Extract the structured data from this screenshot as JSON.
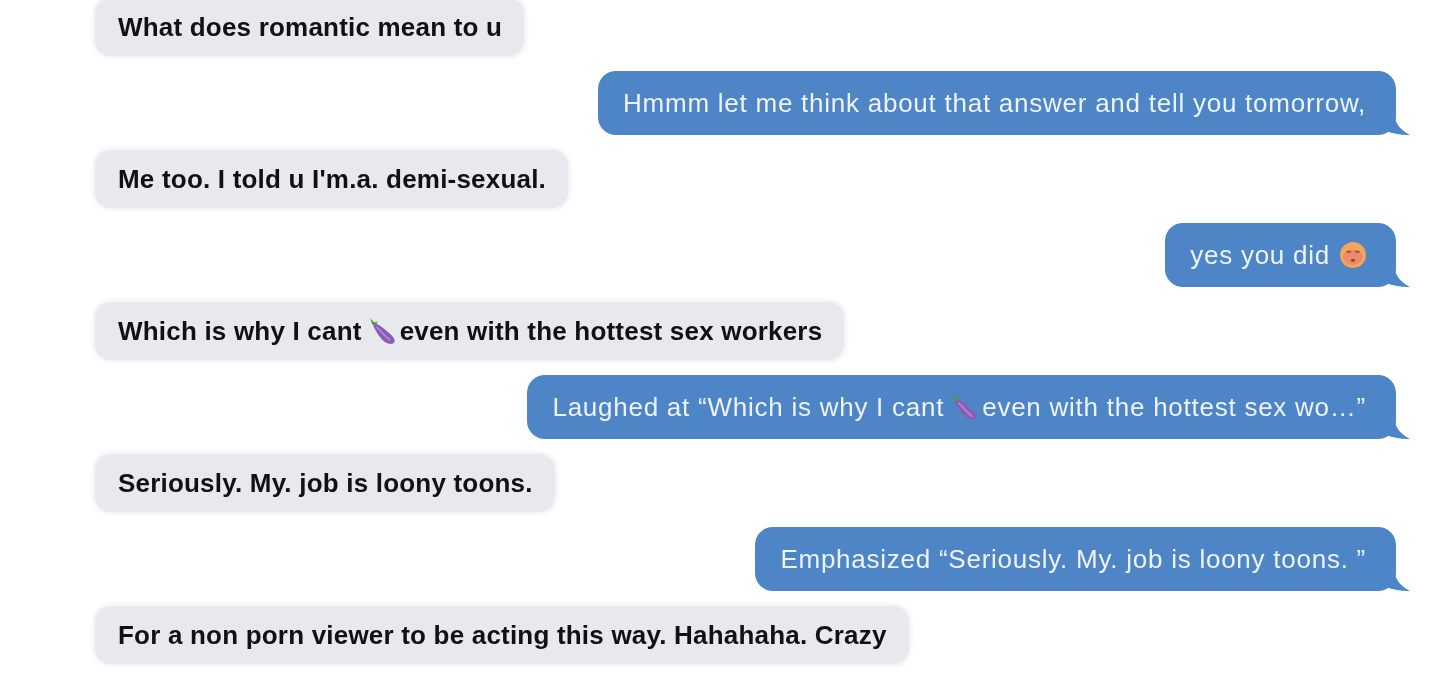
{
  "messages": [
    {
      "kind": "received",
      "parts": [
        {
          "kind": "text",
          "text": "What does romantic mean to u"
        }
      ]
    },
    {
      "kind": "sent",
      "parts": [
        {
          "kind": "text",
          "text": "Hmmm let me think about that answer and tell you tomorrow,"
        }
      ]
    },
    {
      "kind": "received",
      "parts": [
        {
          "kind": "text",
          "text": "Me too. I told u I'm.a. demi-sexual."
        }
      ]
    },
    {
      "kind": "sent",
      "parts": [
        {
          "kind": "text",
          "text": "yes you did"
        },
        {
          "kind": "face"
        }
      ]
    },
    {
      "kind": "received",
      "parts": [
        {
          "kind": "text",
          "text": "Which is why I cant"
        },
        {
          "kind": "eggplant"
        },
        {
          "kind": "text",
          "text": "even with the hottest sex workers"
        }
      ]
    },
    {
      "kind": "sent",
      "parts": [
        {
          "kind": "text",
          "text": "Laughed at “Which is why I cant"
        },
        {
          "kind": "eggplant"
        },
        {
          "kind": "text",
          "text": "even with the hottest sex wo…”"
        }
      ]
    },
    {
      "kind": "received",
      "parts": [
        {
          "kind": "text",
          "text": "Seriously. My. job is loony toons."
        }
      ]
    },
    {
      "kind": "sent",
      "parts": [
        {
          "kind": "text",
          "text": "Emphasized “Seriously. My. job is loony toons. ”"
        }
      ]
    },
    {
      "kind": "received",
      "parts": [
        {
          "kind": "text",
          "text": "For a non porn viewer to be acting this way. Hahahaha. Crazy"
        }
      ]
    }
  ]
}
